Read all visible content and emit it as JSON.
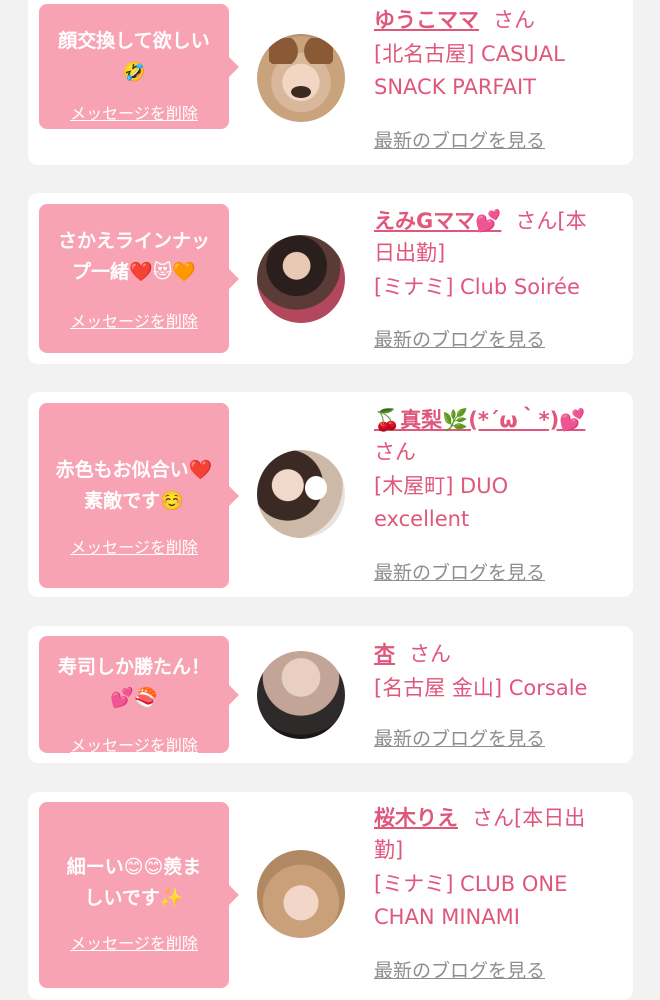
{
  "delete_label": "メッセージを削除",
  "blog_label": "最新のブログを見る",
  "colors": {
    "page_bg": "#f2f2f2",
    "card_bg": "#ffffff",
    "bubble_pink": "#f8a3b3",
    "name_pink": "#e0577d",
    "link_gray": "#8e8e8e"
  },
  "cards": [
    {
      "message": [
        "顔交換して欲しい",
        "🤣"
      ],
      "name": "ゆうこママ",
      "suffix": "さん",
      "shop": [
        "[北名古屋] CASUAL",
        "SNACK PARFAIT"
      ]
    },
    {
      "message": [
        "さかえラインナッ",
        "プ一緒❤️😻🧡"
      ],
      "name": "えみGママ💕",
      "suffix": "さん[本",
      "suffix_line2": "日出勤]",
      "shop": [
        "[ミナミ] Club Soirée"
      ]
    },
    {
      "message": [
        "赤色もお似合い❤️",
        "素敵です☺️"
      ],
      "name": "🍒真梨🌿(*´ω｀*)💕",
      "suffix_line2": "さん",
      "shop": [
        "[木屋町] DUO",
        "excellent"
      ]
    },
    {
      "message": [
        "寿司しか勝たん！",
        "💕🍣"
      ],
      "name": "杏",
      "suffix": "さん",
      "shop": [
        "[名古屋 金山] Corsale"
      ]
    },
    {
      "message": [
        "細ーい😊😊羨ま",
        "しいです✨"
      ],
      "name": "桜木りえ",
      "suffix": "さん[本日出",
      "suffix_line2": "勤]",
      "shop": [
        "[ミナミ] CLUB ONE",
        "CHAN MINAMI"
      ]
    }
  ]
}
